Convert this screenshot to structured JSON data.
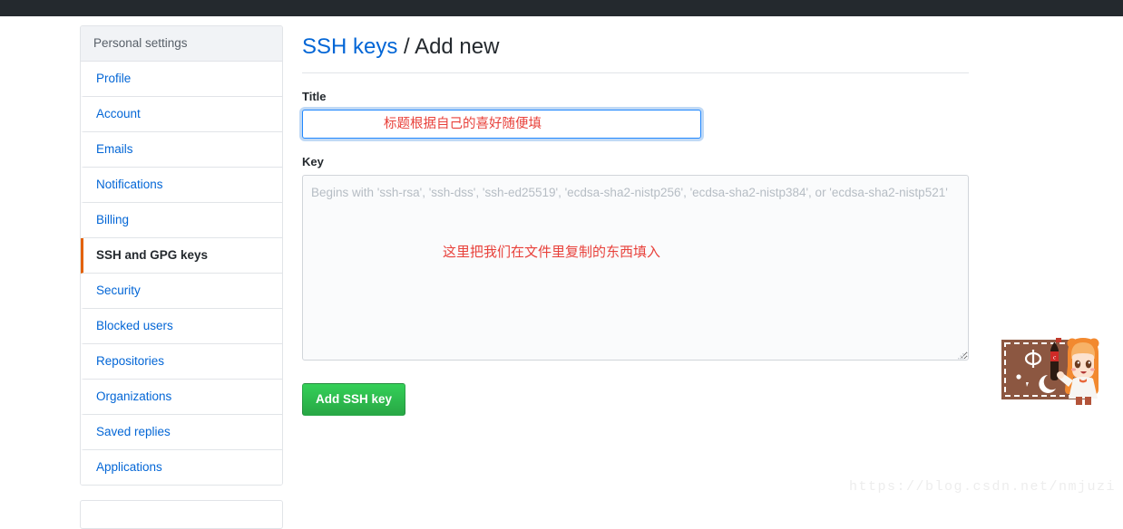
{
  "topbar": {
    "color": "#24292e"
  },
  "sidebar": {
    "heading": "Personal settings",
    "items": [
      {
        "label": "Profile",
        "selected": false
      },
      {
        "label": "Account",
        "selected": false
      },
      {
        "label": "Emails",
        "selected": false
      },
      {
        "label": "Notifications",
        "selected": false
      },
      {
        "label": "Billing",
        "selected": false
      },
      {
        "label": "SSH and GPG keys",
        "selected": true
      },
      {
        "label": "Security",
        "selected": false
      },
      {
        "label": "Blocked users",
        "selected": false
      },
      {
        "label": "Repositories",
        "selected": false
      },
      {
        "label": "Organizations",
        "selected": false
      },
      {
        "label": "Saved replies",
        "selected": false
      },
      {
        "label": "Applications",
        "selected": false
      }
    ],
    "selected_accent_color": "#e36209"
  },
  "main": {
    "heading_link": "SSH keys",
    "heading_separator": "/",
    "heading_current": "Add new",
    "title_field": {
      "label": "Title",
      "value": "",
      "placeholder": "",
      "focused": true,
      "focus_color": "#2188ff"
    },
    "key_field": {
      "label": "Key",
      "value": "",
      "placeholder": "Begins with 'ssh-rsa', 'ssh-dss', 'ssh-ed25519', 'ecdsa-sha2-nistp256', 'ecdsa-sha2-nistp384', or 'ecdsa-sha2-nistp521'"
    },
    "submit_button": {
      "label": "Add SSH key",
      "color": "#28a745"
    }
  },
  "annotations": [
    {
      "text": "标题根据自己的喜好随便填",
      "color": "#e8413b"
    },
    {
      "text": "这里把我们在文件里复制的东西填入",
      "color": "#e8413b"
    }
  ],
  "watermark": {
    "text": "https://blog.csdn.net/nmjuzi"
  },
  "sticker": {
    "name": "umaru-chan-with-cola",
    "box_color": "#8c5741",
    "symbol": "Φ",
    "moon": "☾"
  }
}
